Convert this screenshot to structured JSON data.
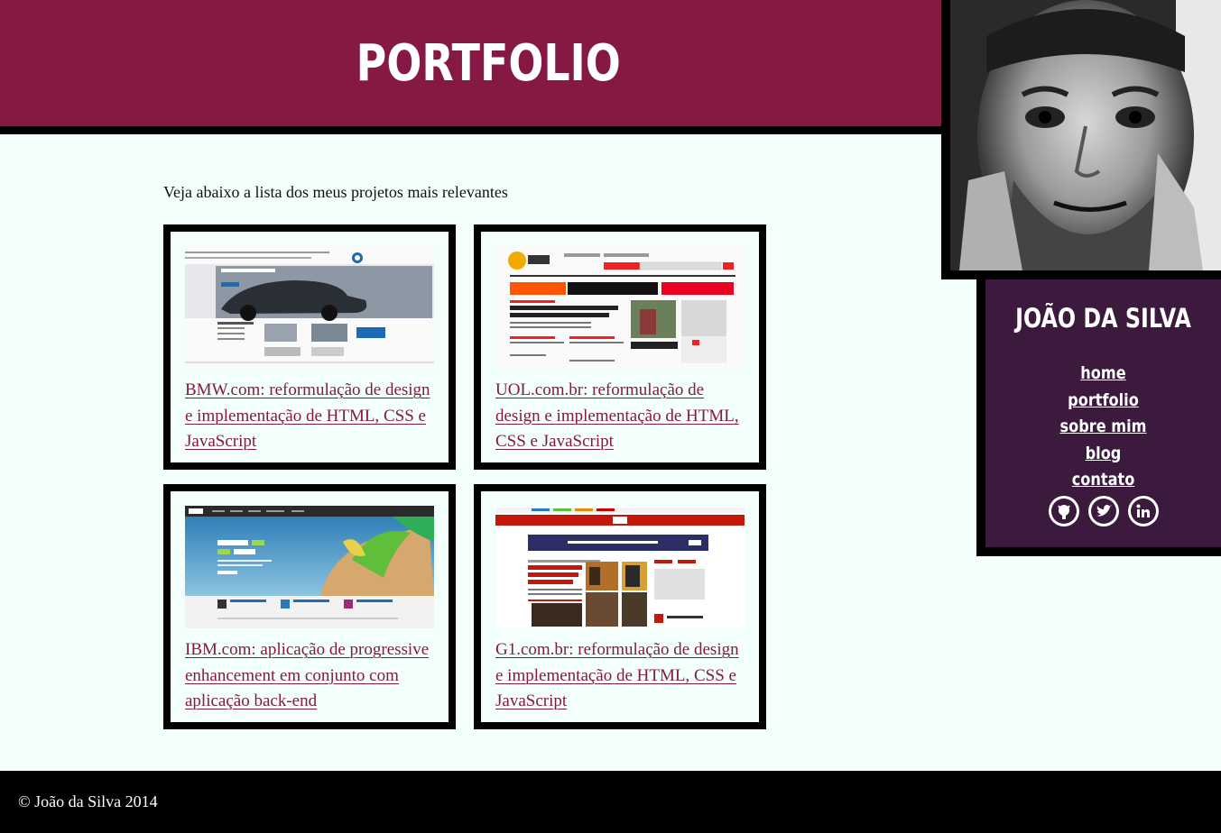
{
  "header": {
    "title": "PORTFOLIO"
  },
  "profile": {
    "name": "JOÃO DA SILVA",
    "photo_icon": "profile-photo",
    "nav": [
      {
        "label": "home"
      },
      {
        "label": "portfolio"
      },
      {
        "label": "sobre mim"
      },
      {
        "label": "blog"
      },
      {
        "label": "contato"
      }
    ],
    "socials": [
      {
        "icon": "github-icon"
      },
      {
        "icon": "twitter-icon"
      },
      {
        "icon": "linkedin-icon"
      }
    ]
  },
  "main": {
    "intro": "Veja abaixo a lista dos meus projetos mais relevantes",
    "projects": [
      {
        "title": "BMW.com: reformulação de design e implementação de HTML, CSS e JavaScript",
        "thumb": "bmw-screenshot"
      },
      {
        "title": "UOL.com.br: reformulação de design e implementação de HTML, CSS e JavaScript",
        "thumb": "uol-screenshot"
      },
      {
        "title": "IBM.com: aplicação de progressive enhancement em conjunto com aplicação back-end",
        "thumb": "ibm-screenshot"
      },
      {
        "title": "G1.com.br: reformulação de design e implementação de HTML, CSS e JavaScript",
        "thumb": "g1-screenshot"
      }
    ]
  },
  "footer": {
    "copyright": "© João da Silva 2014"
  },
  "colors": {
    "header": "#861944",
    "profile": "#3b1a3e",
    "background": "#f3fffb",
    "link": "#861944"
  }
}
